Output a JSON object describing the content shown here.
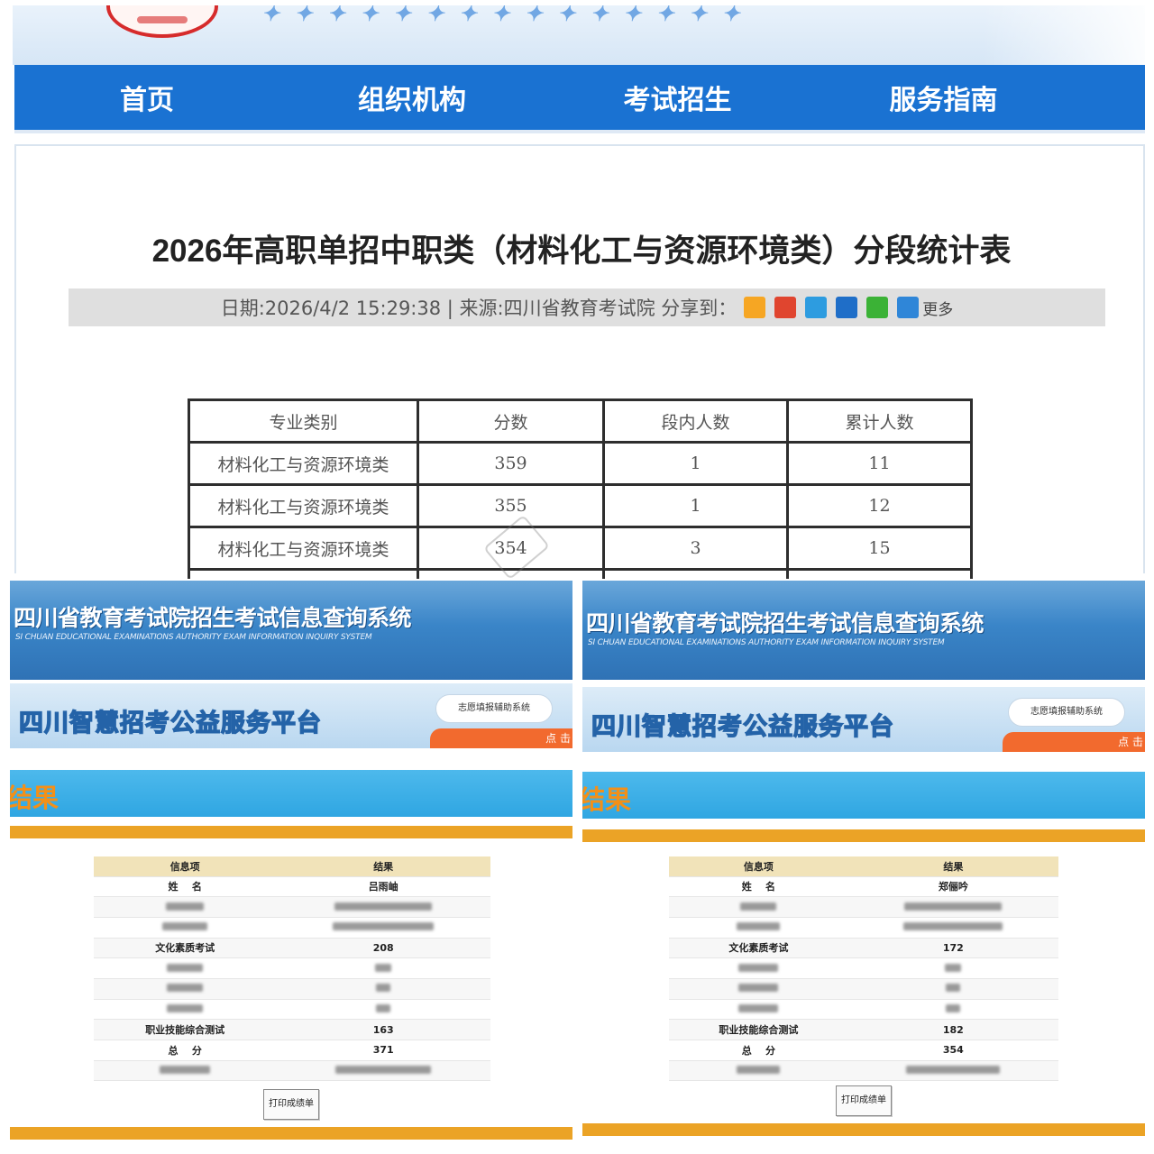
{
  "top": {
    "nav": [
      "首页",
      "组织机构",
      "考试招生",
      "服务指南"
    ],
    "article": {
      "title": "2026年高职单招中职类（材料化工与资源环境类）分段统计表",
      "meta": "日期:2026/4/2 15:29:38 | 来源:四川省教育考试院   分享到：",
      "more": "更多",
      "share_icons": [
        {
          "icon": "qzone-star-icon",
          "color": "#f6a623"
        },
        {
          "icon": "weibo-icon",
          "color": "#e0452f"
        },
        {
          "icon": "qq-weibo-icon",
          "color": "#2d9ce0"
        },
        {
          "icon": "renren-icon",
          "color": "#1f6ec8"
        },
        {
          "icon": "wechat-icon",
          "color": "#3bb236"
        },
        {
          "icon": "plus-more-icon",
          "color": "#2f86d8"
        }
      ]
    },
    "table": {
      "headers": [
        "专业类别",
        "分数",
        "段内人数",
        "累计人数"
      ],
      "rows": [
        [
          "材料化工与资源环境类",
          "359",
          "1",
          "11"
        ],
        [
          "材料化工与资源环境类",
          "355",
          "1",
          "12"
        ],
        [
          "材料化工与资源环境类",
          "354",
          "3",
          "15"
        ]
      ]
    }
  },
  "shots": [
    {
      "sys_title": "四川省教育考试院招生考试信息查询系统",
      "sys_subtitle": "SI CHUAN EDUCATIONAL EXAMINATIONS AUTHORITY EXAM INFORMATION INQUIRY SYSTEM",
      "platform": "四川智慧招考公益服务平台",
      "pill": "志愿填报辅助系统",
      "click": "点 击",
      "result": "结果",
      "head": [
        "信息项",
        "结果"
      ],
      "name_label": "姓    名",
      "name_value": "吕雨岫",
      "culture_label": "文化素质考试",
      "culture_score": "208",
      "skill_label": "职业技能综合测试",
      "skill_score": "163",
      "total_label": "总    分",
      "total_score": "371",
      "print": "打印成绩单"
    },
    {
      "sys_title": "四川省教育考试院招生考试信息查询系统",
      "sys_subtitle": "SI CHUAN EDUCATIONAL EXAMINATIONS AUTHORITY EXAM INFORMATION INQUIRY SYSTEM",
      "platform": "四川智慧招考公益服务平台",
      "pill": "志愿填报辅助系统",
      "click": "点 击",
      "result": "结果",
      "head": [
        "信息项",
        "结果"
      ],
      "name_label": "姓    名",
      "name_value": "郑俪吟",
      "culture_label": "文化素质考试",
      "culture_score": "172",
      "skill_label": "职业技能综合测试",
      "skill_score": "182",
      "total_label": "总    分",
      "total_score": "354",
      "print": "打印成绩单"
    }
  ]
}
